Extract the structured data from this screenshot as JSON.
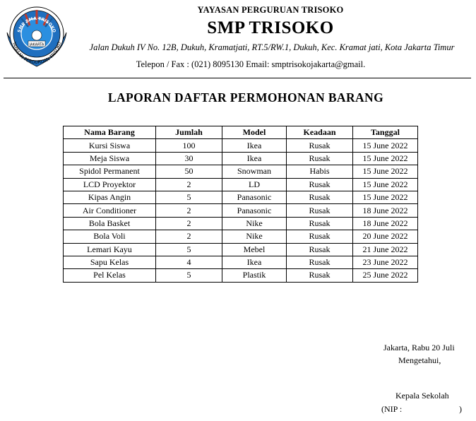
{
  "header": {
    "foundation": "YAYASAN PERGURUAN TRISOKO",
    "school_name": "SMP TRISOKO",
    "address": "Jalan Dukuh IV No. 12B, Dukuh, Kramatjati, RT.5/RW.1, Dukuh, Kec. Kramat jati, Kota Jakarta Timur",
    "contact": "Telepon / Fax : (021) 8095130 Email: smptrisokojakarta@gmail.",
    "logo": {
      "top_text": "SMP SMA TRISOKO",
      "center_text": "JAKARTA",
      "ring_text": "YAYASAN PERGURUAN TRISOKO",
      "colors": {
        "outer": "#1f6fbf",
        "inner": "#2b8fe0",
        "ring": "#ffffff"
      }
    }
  },
  "report": {
    "title": "LAPORAN DAFTAR PERMOHONAN BARANG",
    "columns": [
      "Nama Barang",
      "Jumlah",
      "Model",
      "Keadaan",
      "Tanggal"
    ],
    "rows": [
      [
        "Kursi Siswa",
        "100",
        "Ikea",
        "Rusak",
        "15 June 2022"
      ],
      [
        "Meja Siswa",
        "30",
        "Ikea",
        "Rusak",
        "15 June 2022"
      ],
      [
        "Spidol Permanent",
        "50",
        "Snowman",
        "Habis",
        "15 June 2022"
      ],
      [
        "LCD Proyektor",
        "2",
        "LD",
        "Rusak",
        "15 June 2022"
      ],
      [
        "Kipas Angin",
        "5",
        "Panasonic",
        "Rusak",
        "15 June 2022"
      ],
      [
        "Air Conditioner",
        "2",
        "Panasonic",
        "Rusak",
        "18 June 2022"
      ],
      [
        "Bola Basket",
        "2",
        "Nike",
        "Rusak",
        "18 June 2022"
      ],
      [
        "Bola Voli",
        "2",
        "Nike",
        "Rusak",
        "20 June 2022"
      ],
      [
        "Lemari Kayu",
        "5",
        "Mebel",
        "Rusak",
        "21 June 2022"
      ],
      [
        "Sapu Kelas",
        "4",
        "Ikea",
        "Rusak",
        "23 June 2022"
      ],
      [
        "Pel Kelas",
        "5",
        "Plastik",
        "Rusak",
        "25 June 2022"
      ]
    ]
  },
  "signature": {
    "place_date": "Jakarta, Rabu 20 Juli",
    "acknowledged": "Mengetahui,",
    "role": "Kepala Sekolah",
    "nip_label": "(NIP :",
    "nip_close": ")"
  }
}
